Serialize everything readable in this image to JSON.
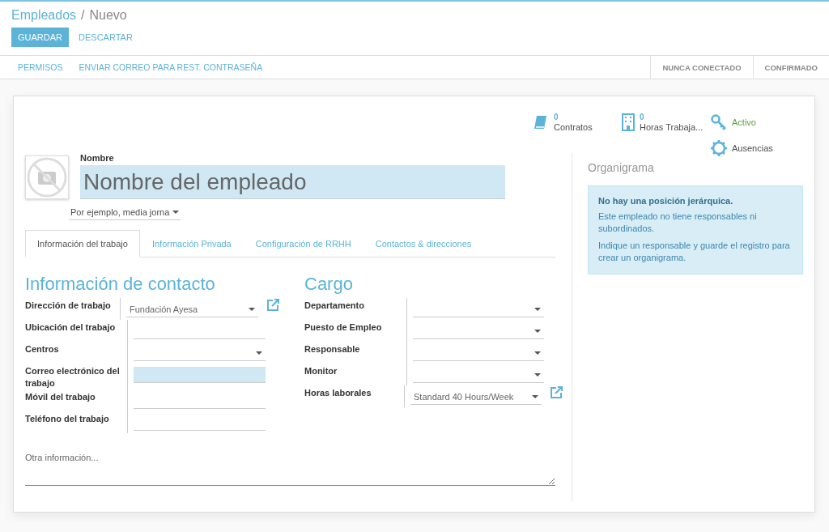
{
  "breadcrumb": {
    "parent": "Empleados",
    "separator": "/",
    "current": "Nuevo"
  },
  "buttons": [
    {
      "label": "GUARDAR",
      "kind": "primary"
    },
    {
      "label": "DESCARTAR",
      "kind": "link"
    }
  ],
  "header_actions": [
    "PERMISOS",
    "ENVIAR CORREO PARA REST. CONTRASEÑA"
  ],
  "status_steps": [
    "NUNCA CONECTADO",
    "CONFIRMADO"
  ],
  "smart_buttons": [
    {
      "kind": "count",
      "value": "0",
      "label": "Contratos"
    },
    {
      "kind": "count",
      "value": "0",
      "label": "Horas Trabaja..."
    },
    {
      "kind": "toggle",
      "label": "Activo",
      "on": true
    },
    {
      "kind": "plain",
      "label": "Ausencias"
    }
  ],
  "name_field": {
    "label": "Nombre",
    "placeholder": "Nombre del empleado",
    "required": true
  },
  "job_title": {
    "placeholder": "Por ejemplo, media jorna"
  },
  "tabs": [
    {
      "label": "Información del trabajo",
      "selected": true
    },
    {
      "label": "Información Privada",
      "selected": false
    },
    {
      "label": "Configuración de RRHH",
      "selected": false
    },
    {
      "label": "Contactos & direcciones",
      "selected": false
    }
  ],
  "groups": [
    {
      "title": "Información de contacto",
      "fields": [
        {
          "label": "Dirección de trabajo",
          "kind": "select",
          "value": "Fundación Ayesa",
          "required": false,
          "external_link": true
        },
        {
          "label": "Ubicación del trabajo",
          "kind": "text",
          "required": false,
          "external_link": false
        },
        {
          "label": "Centros",
          "kind": "select",
          "required": false,
          "external_link": false
        },
        {
          "label": "Correo electrónico del trabajo",
          "kind": "text",
          "required": true,
          "external_link": false
        },
        {
          "label": "Móvil del trabajo",
          "kind": "text",
          "required": false,
          "external_link": false
        },
        {
          "label": "Teléfono del trabajo",
          "kind": "text",
          "required": false,
          "external_link": false
        }
      ]
    },
    {
      "title": "Cargo",
      "fields": [
        {
          "label": "Departamento",
          "kind": "select",
          "required": false,
          "external_link": false
        },
        {
          "label": "Puesto de Empleo",
          "kind": "select",
          "required": false,
          "external_link": false
        },
        {
          "label": "Responsable",
          "kind": "select",
          "required": false,
          "external_link": false
        },
        {
          "label": "Monitor",
          "kind": "select",
          "required": false,
          "external_link": false
        },
        {
          "label": "Horas laborales",
          "kind": "select",
          "value": "Standard 40 Hours/Week",
          "required": false,
          "external_link": true
        }
      ]
    }
  ],
  "notes": {
    "placeholder": "Otra información..."
  },
  "organigram": {
    "title": "Organigrama",
    "alert_title": "No hay una posición jerárquica.",
    "alert_lines": [
      "Este empleado no tiene responsables ni subordinados.",
      "Indique un responsable y guarde el registro para crear un organigrama."
    ]
  }
}
